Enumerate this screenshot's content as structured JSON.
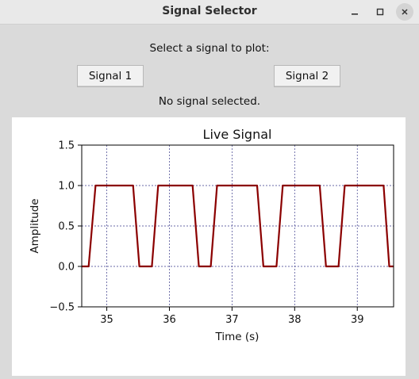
{
  "window": {
    "title": "Signal Selector",
    "controls": [
      "minimize-icon",
      "maximize-icon",
      "close-icon"
    ]
  },
  "prompt": "Select a signal to plot:",
  "buttons": {
    "signal1": "Signal 1",
    "signal2": "Signal 2"
  },
  "status": "No signal selected.",
  "colors": {
    "line": "#8b0000",
    "grid": "#3a3a8a",
    "background": "#dadada"
  },
  "chart_data": {
    "type": "line",
    "title": "Live Signal",
    "xlabel": "Time (s)",
    "ylabel": "Amplitude",
    "xlim": [
      34.6,
      39.58
    ],
    "ylim": [
      -0.5,
      1.5
    ],
    "xticks": [
      35,
      36,
      37,
      38,
      39
    ],
    "yticks": [
      -0.5,
      0.0,
      0.5,
      1.0,
      1.5
    ],
    "ytick_labels": [
      "−0.5",
      "0.0",
      "0.5",
      "1.0",
      "1.5"
    ],
    "grid": true,
    "series": [
      {
        "x": [
          34.6,
          34.71,
          34.82,
          35.42,
          35.52,
          35.62,
          35.72,
          35.82,
          36.37,
          36.47,
          36.56,
          36.66,
          36.76,
          37.4,
          37.5,
          37.61,
          37.71,
          37.81,
          38.4,
          38.5,
          38.6,
          38.7,
          38.8,
          39.42,
          39.51,
          39.58
        ],
        "y": [
          0,
          0,
          1,
          1,
          0,
          0,
          0,
          1,
          1,
          0,
          0,
          0,
          1,
          1,
          0,
          0,
          0,
          1,
          1,
          0,
          0,
          0,
          1,
          1,
          0,
          0
        ]
      }
    ]
  }
}
